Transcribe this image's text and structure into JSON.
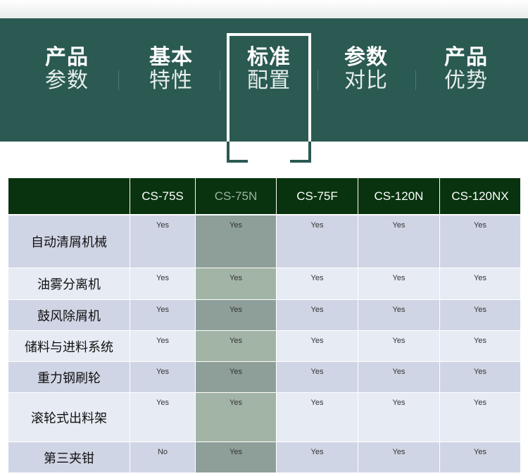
{
  "nav": {
    "items": [
      {
        "line1": "产品",
        "line2": "参数"
      },
      {
        "line1": "基本",
        "line2": "特性"
      },
      {
        "line1": "标准",
        "line2": "配置"
      },
      {
        "line1": "参数",
        "line2": "对比"
      },
      {
        "line1": "产品",
        "line2": "优势"
      }
    ],
    "active_index": 2
  },
  "table": {
    "columns": [
      "",
      "CS-75S",
      "CS-75N",
      "CS-75F",
      "CS-120N",
      "CS-120NX"
    ],
    "highlight_column": "CS-75N",
    "rows": [
      {
        "feature": "自动清屑机械",
        "values": [
          "Yes",
          "Yes",
          "Yes",
          "Yes",
          "Yes"
        ]
      },
      {
        "feature": "油雾分离机",
        "values": [
          "Yes",
          "Yes",
          "Yes",
          "Yes",
          "Yes"
        ]
      },
      {
        "feature": "鼓风除屑机",
        "values": [
          "Yes",
          "Yes",
          "Yes",
          "Yes",
          "Yes"
        ]
      },
      {
        "feature": "储料与进料系统",
        "values": [
          "Yes",
          "Yes",
          "Yes",
          "Yes",
          "Yes"
        ]
      },
      {
        "feature": "重力钢刷轮",
        "values": [
          "Yes",
          "Yes",
          "Yes",
          "Yes",
          "Yes"
        ]
      },
      {
        "feature": "滚轮式出料架",
        "values": [
          "Yes",
          "Yes",
          "Yes",
          "Yes",
          "Yes"
        ]
      },
      {
        "feature": "第三夹钳",
        "values": [
          "No",
          "Yes",
          "Yes",
          "Yes",
          "Yes"
        ]
      }
    ]
  },
  "colors": {
    "banner": "#2a5a52",
    "table_header": "#08330e",
    "row_odd": "#d0d5e5",
    "row_even": "#e6ebf4",
    "highlight_odd": "#8e9f99",
    "highlight_even": "#a2b4a6"
  }
}
